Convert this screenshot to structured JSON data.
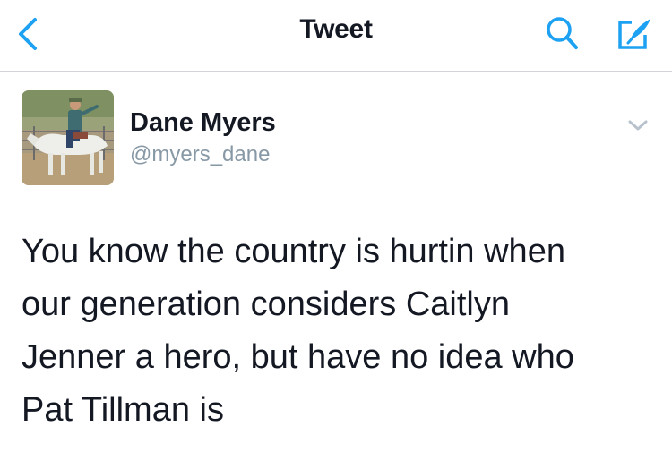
{
  "colors": {
    "accent": "#1da1f2",
    "text": "#141823",
    "secondary_text": "#8899a6",
    "divider": "#d4d4d8"
  },
  "navbar": {
    "title": "Tweet",
    "back_icon": "chevron-left-icon",
    "search_icon": "search-icon",
    "compose_icon": "compose-icon"
  },
  "tweet": {
    "author": {
      "name": "Dane Myers",
      "handle": "@myers_dane",
      "avatar_icon": "avatar-photo"
    },
    "caret_icon": "chevron-down-icon",
    "text_lines": [
      "You know the country is hurtin when",
      "our generation considers Caitlyn",
      "Jenner a hero, but have no idea who",
      "Pat Tillman is"
    ]
  }
}
